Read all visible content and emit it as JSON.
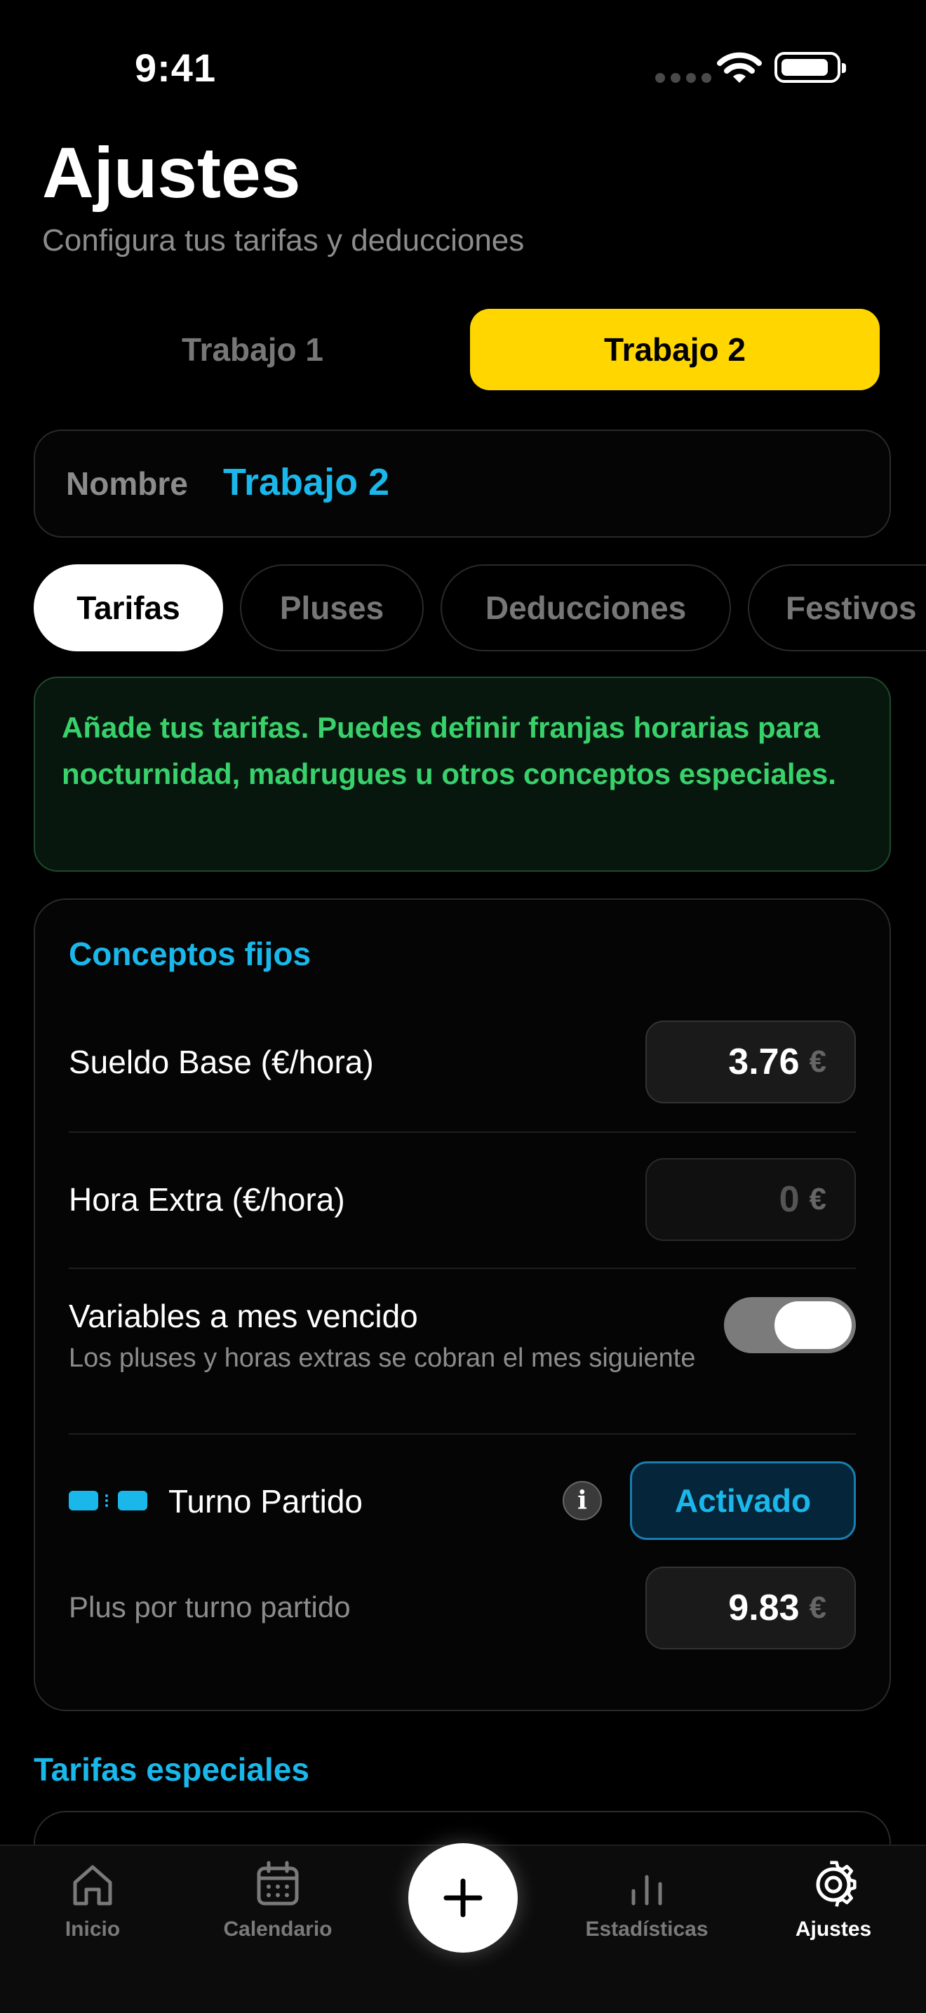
{
  "status": {
    "time": "9:41"
  },
  "header": {
    "title": "Ajustes",
    "subtitle": "Configura tus tarifas y deducciones"
  },
  "jobs": {
    "tab1": "Trabajo 1",
    "tab2": "Trabajo 2",
    "selected": "Trabajo 2"
  },
  "name_field": {
    "label": "Nombre",
    "value": "Trabajo 2"
  },
  "section_tabs": [
    "Tarifas",
    "Pluses",
    "Deducciones",
    "Festivos"
  ],
  "info_banner": "Añade tus tarifas. Puedes definir franjas horarias para nocturnidad, madrugues u otros conceptos especiales.",
  "fixed": {
    "title": "Conceptos fijos",
    "base_label": "Sueldo Base (€/hora)",
    "base_value": "3.76",
    "overtime_label": "Hora Extra (€/hora)",
    "overtime_value": "0",
    "currency": "€",
    "variables_label": "Variables a mes vencido",
    "variables_desc": "Los pluses y horas extras se cobran el mes siguiente",
    "variables_on": true,
    "split_label": "Turno Partido",
    "split_state": "Activado",
    "split_plus_label": "Plus por turno partido",
    "split_plus_value": "9.83"
  },
  "special": {
    "title": "Tarifas especiales"
  },
  "tabbar": {
    "home": "Inicio",
    "calendar": "Calendario",
    "stats": "Estadísticas",
    "settings": "Ajustes",
    "active": "Ajustes"
  },
  "icons": [
    "home-icon",
    "calendar-icon",
    "plus-icon",
    "stats-icon",
    "gear-icon",
    "info-icon",
    "wifi-icon",
    "battery-icon"
  ],
  "colors": {
    "accent_yellow": "#FFD600",
    "accent_blue": "#1AB7EA",
    "success_green": "#39D16B",
    "background": "#000000"
  }
}
